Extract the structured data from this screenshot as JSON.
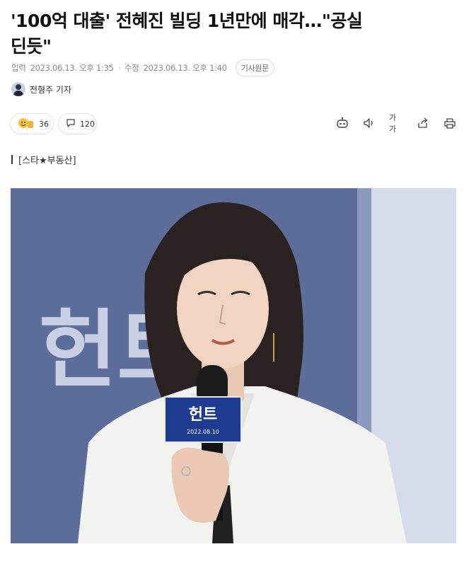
{
  "article": {
    "headline_line1": "'100억 대출' 전혜진 빌딩 1년만에 매각…\"공실",
    "headline_line2": "딘듯\"",
    "input_label": "입력",
    "input_time": "2023.06.13. 오후 1:35",
    "edit_label": "수정",
    "edit_time": "2023.06.13. 오후 1:40",
    "original_button": "기사원문",
    "reporter": "전형주 기자",
    "reaction_count": "36",
    "comment_count": "120",
    "font_size_label": "가가",
    "category": "[스타★부동산]"
  },
  "photo": {
    "backdrop_title": "헌트",
    "mic_flag_title": "헌트",
    "mic_flag_date": "2022.08.10"
  },
  "caption": "",
  "colors": {
    "backdrop": "#5a6b97",
    "backdrop_light": "#d7dded",
    "jacket": "#f2f2f0",
    "hair": "#2a2220",
    "mic_flag": "#1d3b8f"
  },
  "icons": [
    "robot-icon",
    "speaker-icon",
    "share-icon",
    "print-icon",
    "comment-icon",
    "reaction-icon"
  ]
}
